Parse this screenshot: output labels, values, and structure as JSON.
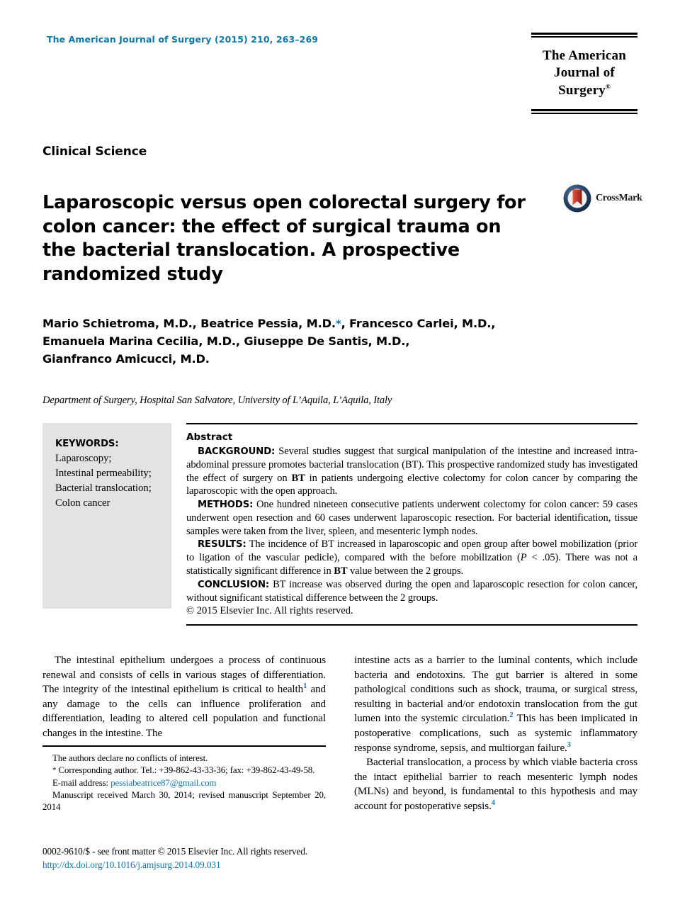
{
  "masthead": {
    "journal_reference": "The American Journal of Surgery (2015) 210, 263–269",
    "accent_color": "#0d78ab"
  },
  "logo": {
    "line1": "The American",
    "line2": "Journal of Surgery",
    "trademark": "®"
  },
  "section_label": "Clinical Science",
  "title": "Laparoscopic versus open colorectal surgery for colon cancer: the effect of surgical trauma on the bacterial translocation. A prospective randomized study",
  "crossmark": {
    "label": "CrossMark",
    "ring_color": "#1b3a63",
    "mark_color": "#c0392b"
  },
  "authors": {
    "line1_a": "Mario Schietroma, M.D., Beatrice Pessia, M.D.",
    "corresponding_marker": "*",
    "line1_b": ", Francesco Carlei, M.D.,",
    "line2": "Emanuela Marina Cecilia, M.D., Giuseppe De Santis, M.D.,",
    "line3": "Gianfranco Amicucci, M.D."
  },
  "affiliation": "Department of Surgery, Hospital San Salvatore, University of L’Aquila, L’Aquila, Italy",
  "keywords": {
    "heading": "KEYWORDS:",
    "items": [
      "Laparoscopy;",
      "Intestinal permeability;",
      "Bacterial translocation;",
      "Colon cancer"
    ]
  },
  "abstract": {
    "heading": "Abstract",
    "background_label": "BACKGROUND:",
    "background_text_1": "Several studies suggest that surgical manipulation of the intestine and increased intra-abdominal pressure promotes bacterial translocation (BT). This prospective randomized study has investigated the effect of surgery on ",
    "background_bt": "BT",
    "background_text_2": " in patients undergoing elective colectomy for colon cancer by comparing the laparoscopic with the open approach.",
    "methods_label": "METHODS:",
    "methods_text": "One hundred nineteen consecutive patients underwent colectomy for colon cancer: 59 cases underwent open resection and 60 cases underwent laparoscopic resection. For bacterial identification, tissue samples were taken from the liver, spleen, and mesenteric lymph nodes.",
    "results_label": "RESULTS:",
    "results_text_1": "The incidence of BT increased in laparoscopic and open group after bowel mobilization (prior to ligation of the vascular pedicle), compared with the before mobilization (",
    "results_p_italic": "P",
    "results_text_2": " < .05). There was not a statistically significant difference in ",
    "results_bt": "BT",
    "results_text_3": " value between the 2 groups.",
    "conclusion_label": "CONCLUSION:",
    "conclusion_text": "BT increase was observed during the open and laparoscopic resection for colon cancer, without significant statistical difference between the 2 groups.",
    "copyright": "© 2015 Elsevier Inc. All rights reserved."
  },
  "body": {
    "left_para_1_a": "The intestinal epithelium undergoes a process of continuous renewal and consists of cells in various stages of differentiation. The integrity of the intestinal epithelium is critical to health",
    "left_para_1_ref": "1",
    "left_para_1_b": " and any damage to the cells can influence proliferation and differentiation, leading to altered cell population and functional changes in the intestine. The",
    "right_para_1_a": "intestine acts as a barrier to the luminal contents, which include bacteria and endotoxins. The gut barrier is altered in some pathological conditions such as shock, trauma, or surgical stress, resulting in bacterial and/or endotoxin translocation from the gut lumen into the systemic circulation.",
    "right_para_1_ref": "2",
    "right_para_1_b": " This has been implicated in postoperative complications, such as systemic inflammatory response syndrome, sepsis, and multiorgan failure.",
    "right_para_1_ref2": "3",
    "right_para_2_a": "Bacterial translocation, a process by which viable bacteria cross the intact epithelial barrier to reach mesenteric lymph nodes (MLNs) and beyond, is fundamental to this hypothesis and may account for postoperative sepsis.",
    "right_para_2_ref": "4"
  },
  "footnotes": {
    "conflicts": "The authors declare no conflicts of interest.",
    "corresponding_marker": "*",
    "corresponding": " Corresponding author. Tel.: +39-862-43-33-36; fax: +39-862-43-49-58.",
    "email_label": "E-mail address: ",
    "email": "pessiabeatrice87@gmail.com",
    "received": "Manuscript received March 30, 2014; revised manuscript September 20, 2014"
  },
  "page_footer": {
    "issn": "0002-9610/$ - see front matter © 2015 Elsevier Inc. All rights reserved.",
    "doi": "http://dx.doi.org/10.1016/j.amjsurg.2014.09.031"
  }
}
